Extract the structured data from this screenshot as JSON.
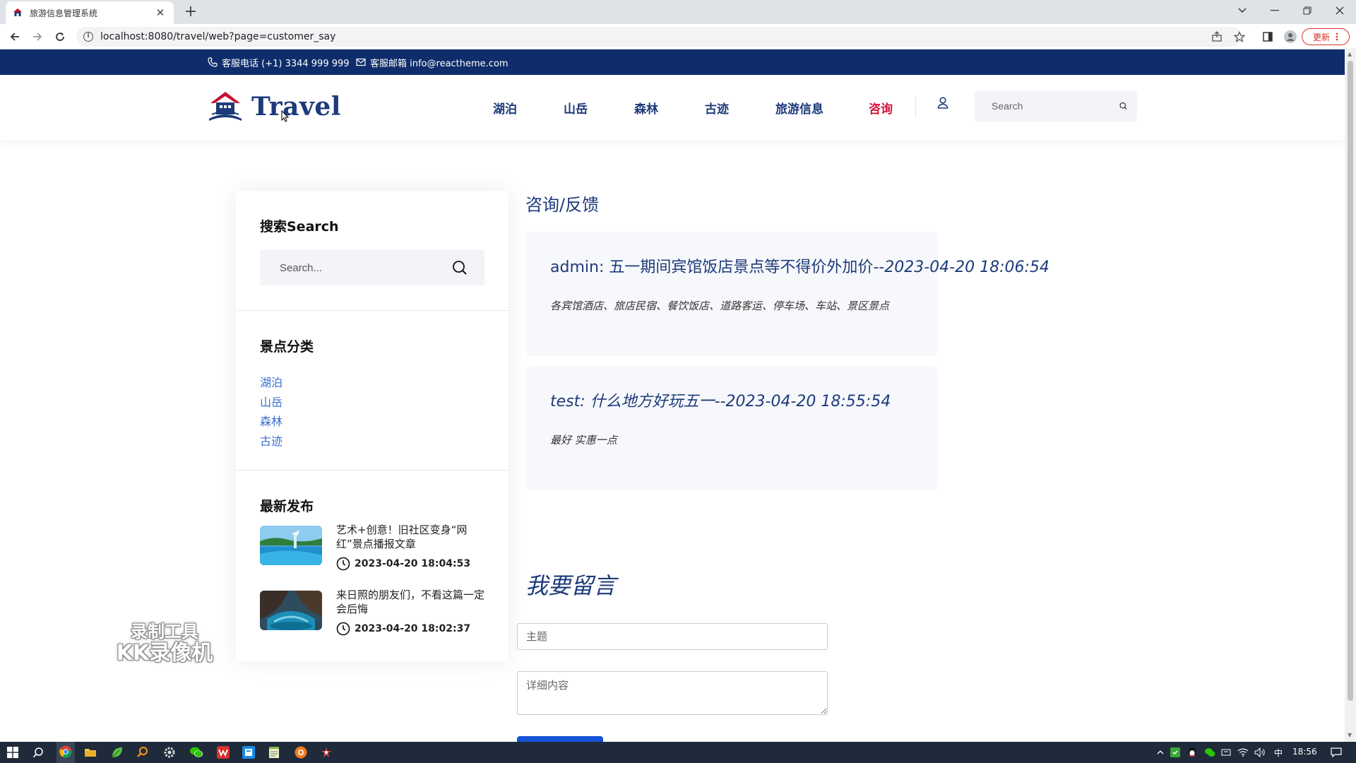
{
  "browser": {
    "tab_title": "旅游信息管理系统",
    "tab_close": "✕",
    "new_tab": "+",
    "url": "localhost:8080/travel/web?page=customer_say",
    "update_label": "更新",
    "info_symbol": "i"
  },
  "topbar": {
    "phone": "客服电话 (+1) 3344 999 999",
    "email": "客服邮箱 info@reactheme.com"
  },
  "header": {
    "logo_text": "Travel",
    "nav": [
      "湖泊",
      "山岳",
      "森林",
      "古迹",
      "旅游信息",
      "咨询"
    ],
    "active_nav_index": 5,
    "search_placeholder": "Search"
  },
  "sidebar": {
    "search_title": "搜索Search",
    "search_placeholder": "Search...",
    "categories_title": "景点分类",
    "categories": [
      "湖泊",
      "山岳",
      "森林",
      "古迹"
    ],
    "latest_title": "最新发布",
    "posts": [
      {
        "title": "艺术+创意！旧社区变身“网红”景点播报文章",
        "date": "2023-04-20 18:04:53"
      },
      {
        "title": "来日照的朋友们，不看这篇一定会后悔",
        "date": "2023-04-20 18:02:37"
      }
    ]
  },
  "main": {
    "heading": "咨询/反馈",
    "messages": [
      {
        "user": "admin",
        "subject": "五一期间宾馆饭店景点等不得价外加价",
        "date": "--2023-04-20 18:06:54",
        "body": "各宾馆酒店、旅店民宿、餐饮饭店、道路客运、停车场、车站、景区景点"
      },
      {
        "user": "test",
        "subject": "什么地方好玩五一",
        "date": "--2023-04-20 18:55:54",
        "body": "最好 实惠一点"
      }
    ],
    "form_heading": "我要留言",
    "subject_placeholder": "主题",
    "content_placeholder": "详细内容"
  },
  "watermark": {
    "line1": "录制工具",
    "line2": "KK录像机"
  },
  "taskbar": {
    "ime": "中",
    "time": "18:56"
  },
  "colors": {
    "navy": "#0f2d6b",
    "brand_blue": "#1d3a7a",
    "active_red": "#d3143a",
    "link_blue": "#3b6fd1"
  }
}
